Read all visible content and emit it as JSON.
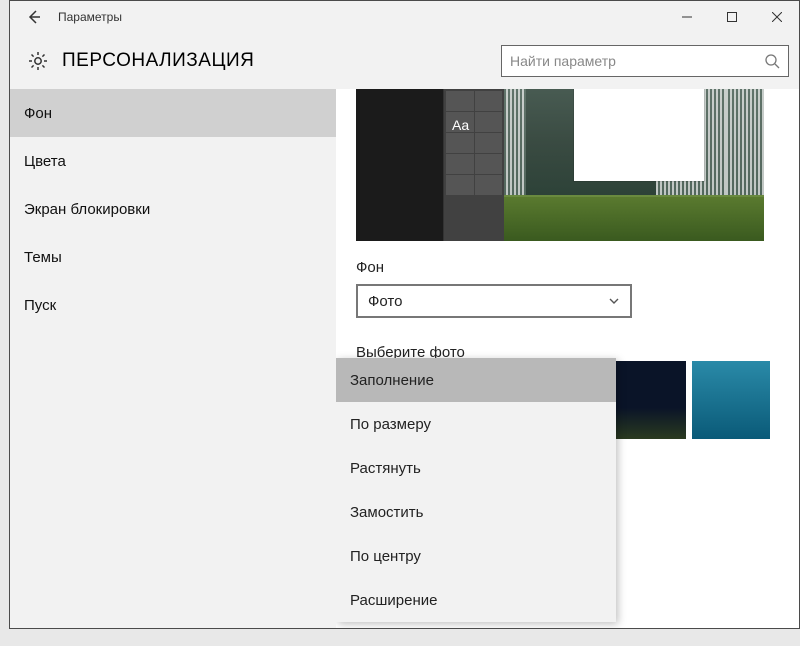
{
  "titlebar": {
    "title": "Параметры"
  },
  "header": {
    "title": "ПЕРСОНАЛИЗАЦИЯ",
    "search_placeholder": "Найти параметр"
  },
  "sidebar": {
    "items": [
      {
        "label": "Фон",
        "selected": true
      },
      {
        "label": "Цвета",
        "selected": false
      },
      {
        "label": "Экран блокировки",
        "selected": false
      },
      {
        "label": "Темы",
        "selected": false
      },
      {
        "label": "Пуск",
        "selected": false
      }
    ]
  },
  "content": {
    "preview_sample_text": "Aa",
    "bg_label": "Фон",
    "bg_dropdown_value": "Фото",
    "choose_label": "Выберите фото"
  },
  "fit_menu": {
    "options": [
      {
        "label": "Заполнение",
        "selected": true
      },
      {
        "label": "По размеру",
        "selected": false
      },
      {
        "label": "Растянуть",
        "selected": false
      },
      {
        "label": "Замостить",
        "selected": false
      },
      {
        "label": "По центру",
        "selected": false
      },
      {
        "label": "Расширение",
        "selected": false
      }
    ]
  }
}
